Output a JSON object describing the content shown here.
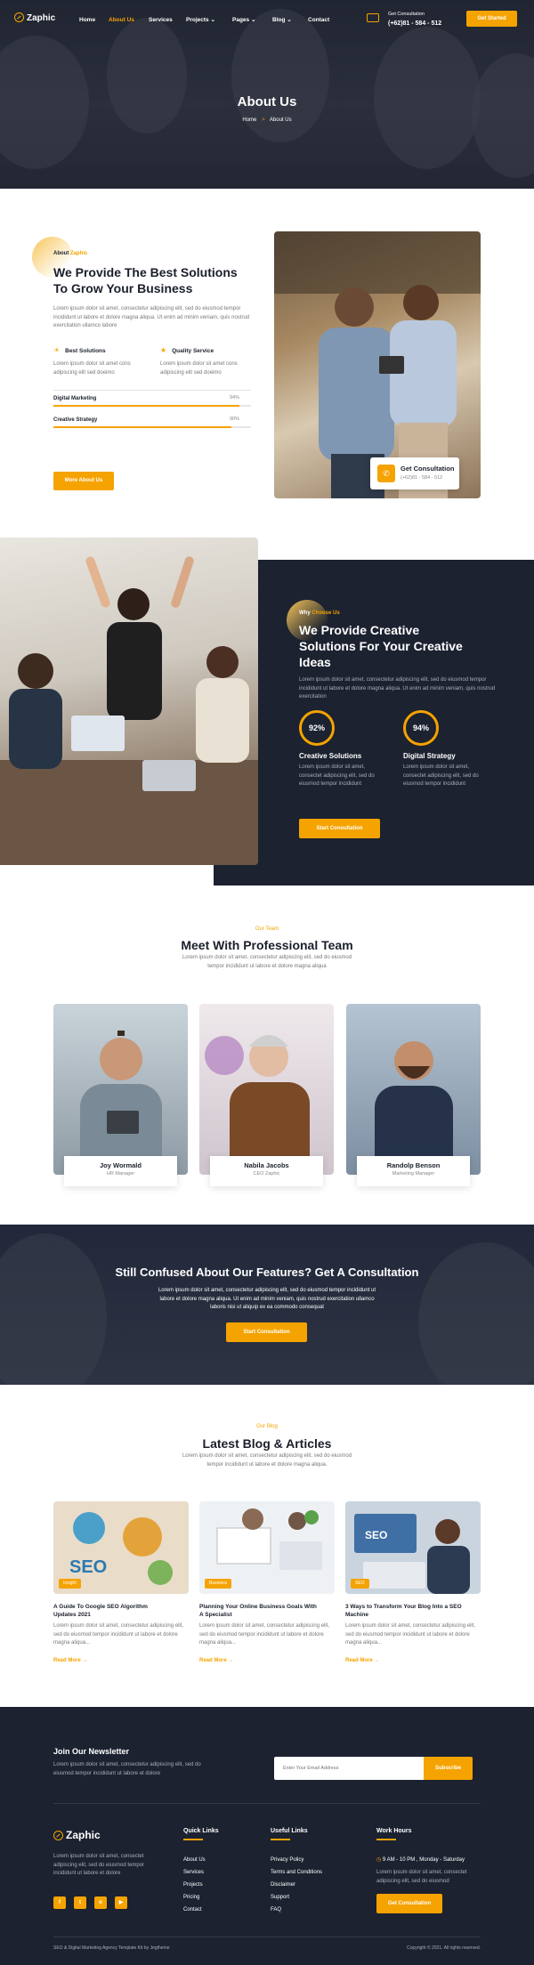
{
  "brand": {
    "name": "Zaphic",
    "accent": "#f5a300",
    "dark": "#1c2230"
  },
  "nav": {
    "items": [
      "Home",
      "About Us",
      "Services",
      "Projects",
      "Pages",
      "Blog",
      "Contact"
    ],
    "active": "About Us",
    "consult_label": "Get Consultation",
    "consult_phone": "(+62)81 - 584 - 512",
    "cta": "Get Started"
  },
  "hero": {
    "title": "About Us",
    "crumb_home": "Home",
    "crumb_sep": ">",
    "crumb_current": "About Us"
  },
  "about": {
    "eyebrow_prefix": "About ",
    "eyebrow_accent": "Zaphic",
    "title_line1": "We Provide The Best Solutions",
    "title_line2": "To Grow Your Business",
    "text": "Lorem ipsum dolor sit amet, consectetur adipiscing elit, sed do eiusmod tempor incididunt ut labore et dolore magna aliqua. Ut enim ad minim veniam, quis nostrud exercitation ullamco labore",
    "features": [
      {
        "icon": "bulb-icon",
        "title": "Best Solutions",
        "text": "Lorem ipsum dolor sit amet cons adipiscing elit sed doeimo"
      },
      {
        "icon": "star-icon",
        "title": "Quality Service",
        "text": "Lorem ipsum dolor sit amet cons adipiscing elit sed doeimo"
      }
    ],
    "skills": [
      {
        "name": "Digital Marketing",
        "label": "94%",
        "value": 94
      },
      {
        "name": "Creative Strategy",
        "label": "90%",
        "value": 90
      }
    ],
    "button": "More About Us",
    "badge_title": "Get Consultation",
    "badge_phone": "(+62)81 - 584 - 512"
  },
  "why": {
    "eyebrow_prefix": "Why ",
    "eyebrow_accent": "Choose Us",
    "title_line1": "We Provide Creative",
    "title_line2": "Solutions For Your Creative",
    "title_line3": "Ideas",
    "text": "Lorem ipsum dolor sit amet, consectetur adipiscing elit, sed do eiusmod tempor incididunt ut labore et dolore magna aliqua. Ut enim ad minim veniam, quis nostrud exercitation",
    "stats": [
      {
        "label": "92%",
        "value": 92,
        "title": "Creative Solutions",
        "text": "Lorem ipsum dolor sit amet, consectet adipiscing elit, sed do eiusmod tempor incididunt"
      },
      {
        "label": "94%",
        "value": 94,
        "title": "Digital Strategy",
        "text": "Lorem ipsum dolor sit amet, consectet adipiscing elit, sed do eiusmod tempor incididunt"
      }
    ],
    "button": "Start Consultation"
  },
  "team": {
    "eyebrow": "Our Team",
    "title": "Meet With Professional Team",
    "subtitle_line1": "Lorem ipsum dolor sit amet, consectetur adipiscing elit, sed do eiusmod",
    "subtitle_line2": "tempor incididunt ut labore et dolore magna aliqua",
    "members": [
      {
        "name": "Joy Wormald",
        "role": "HR Manager"
      },
      {
        "name": "Nabila Jacobs",
        "role": "CEO Zaphic"
      },
      {
        "name": "Randolp Benson",
        "role": "Marketing Manager"
      }
    ]
  },
  "cta": {
    "title": "Still Confused About Our Features? Get A Consultation",
    "text_line1": "Lorem ipsum dolor sit amet, consectetur adipiscing elit, sed do eiusmod tempor incididunt ut",
    "text_line2": "labore et dolore magna aliqua. Ut enim ad minim veniam, quis nostrud exercitation ullamco",
    "text_line3": "laboris nisi ut aliquip ex ea commodo consequat",
    "button": "Start Consultation"
  },
  "blog": {
    "eyebrow": "Our Blog",
    "title": "Latest Blog & Articles",
    "subtitle_line1": "Lorem ipsum dolor sit amet, consectetur adipiscing elit, sed do eiusmod",
    "subtitle_line2": "tempor incididunt ut labore et dolore magna aliqua.",
    "posts": [
      {
        "tag": "Insight",
        "title_line1": "A Guide To Google SEO Algorithm",
        "title_line2": "Updates 2021",
        "excerpt": "Lorem ipsum dolor sit amet, consectetur adipiscing elit, sed do eiusmod tempor incididunt ut labore et dolore magna aliqua...",
        "more": "Read More"
      },
      {
        "tag": "Business",
        "title_line1": "Planning Your Online Business Goals With",
        "title_line2": "A Specialist",
        "excerpt": "Lorem ipsum dolor sit amet, consectetur adipiscing elit, sed do eiusmod tempor incididunt ut labore et dolore magna aliqua...",
        "more": "Read More"
      },
      {
        "tag": "SEO",
        "title_line1": "3 Ways to Transform Your Blog Into a SEO",
        "title_line2": "Machine",
        "excerpt": "Lorem ipsum dolor sit amet, consectetur adipiscing elit, sed do eiusmod tempor incididunt ut labore et dolore magna aliqua...",
        "more": "Read More"
      }
    ],
    "seo_word": "SEO"
  },
  "newsletter": {
    "title": "Join Our Newsletter",
    "text_line1": "Lorem ipsum dolor sit amet, consectetur adipiscing elit, sed do",
    "text_line2": "eiusmod tempor incididunt ut labore et dolore",
    "placeholder": "Enter Your Email Address",
    "button": "Subscribe"
  },
  "footer": {
    "about_line1": "Lorem ipsum dolor sit amet, consectet",
    "about_line2": "adipiscing elit, sed do eiusmod tempor",
    "about_line3": "incididunt ut labore et dolore",
    "socials": [
      {
        "icon": "facebook-icon",
        "glyph": "f"
      },
      {
        "icon": "twitter-icon",
        "glyph": "t"
      },
      {
        "icon": "instagram-icon",
        "glyph": "o"
      },
      {
        "icon": "youtube-icon",
        "glyph": "▶"
      }
    ],
    "quick_title": "Quick Links",
    "quick_links": [
      "About Us",
      "Services",
      "Projects",
      "Pricing",
      "Contact"
    ],
    "useful_title": "Useful Links",
    "useful_links": [
      "Privacy Policy",
      "Terms and Conditions",
      "Disclaimer",
      "Support",
      "FAQ"
    ],
    "hours_title": "Work Hours",
    "hours_time": "9 AM - 10 PM , Monday - Saturday",
    "hours_text_line1": "Lorem ipsum dolor sit amet, consectet",
    "hours_text_line2": "adipiscing elit, sed do eiusmod",
    "hours_button": "Get Consultation",
    "bottom_left": "SEO & Digital Marketing Agency Template Kit by Jegtheme",
    "bottom_right": "Copyright © 2021. All rights reserved."
  }
}
